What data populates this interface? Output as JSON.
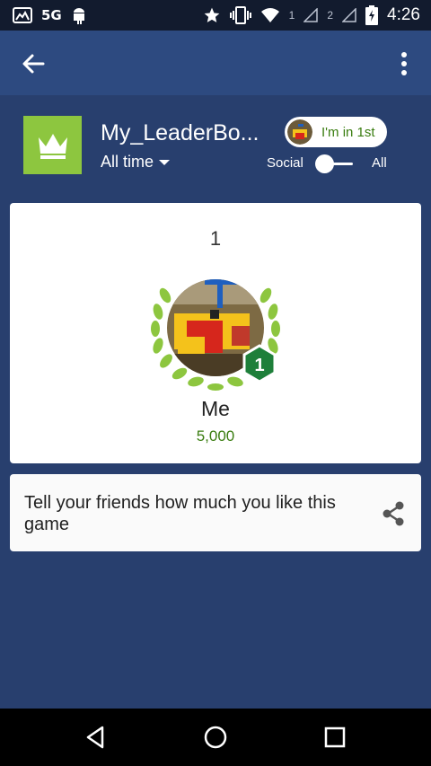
{
  "status_bar": {
    "carrier": "5G",
    "sim1": "1",
    "sim2": "2",
    "time": "4:26",
    "icons": [
      "gallery-icon",
      "5g-icon",
      "android-icon",
      "star-icon",
      "vibrate-icon",
      "wifi-icon",
      "signal-icon",
      "signal-icon",
      "battery-charging-icon"
    ]
  },
  "app_bar": {
    "back_icon": "arrow-back-icon",
    "menu_icon": "more-vert-icon"
  },
  "header": {
    "title": "My_LeaderBo...",
    "time_filter": "All time",
    "rank_pill": "I'm in 1st",
    "toggle_left": "Social",
    "toggle_right": "All",
    "game_icon": "crown-icon"
  },
  "rank_card": {
    "rank": "1",
    "name": "Me",
    "score": "5,000",
    "badge": "1"
  },
  "share_card": {
    "text": "Tell your friends how much you like this game",
    "icon": "share-icon"
  },
  "nav_bar": {
    "icons": [
      "back-triangle-icon",
      "home-circle-icon",
      "recents-square-icon"
    ]
  },
  "colors": {
    "background": "#283f6e",
    "app_bar": "#2d4a80",
    "accent_green": "#8dc63f",
    "score_green": "#3a7d10",
    "badge_green": "#1e7f3a"
  }
}
